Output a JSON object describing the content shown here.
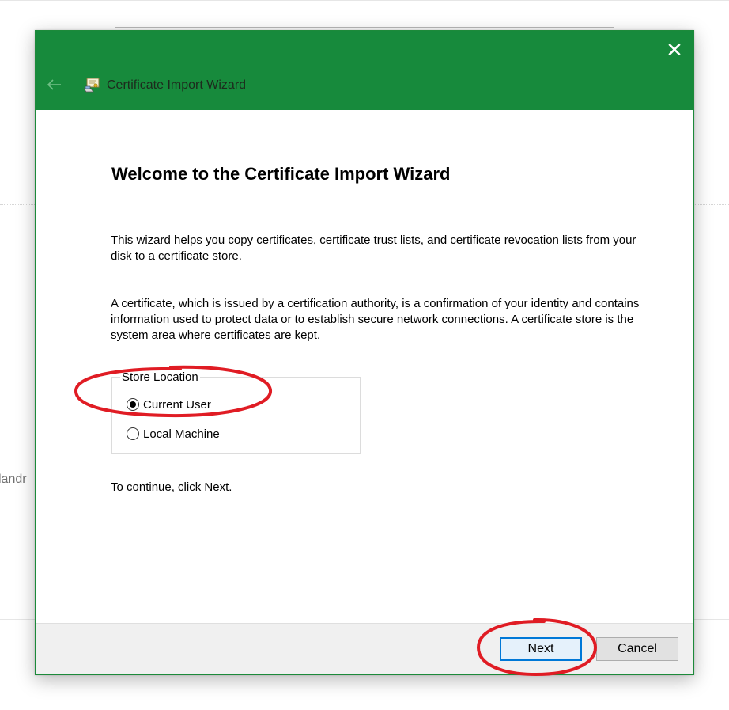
{
  "background": {
    "partial_text": "landr"
  },
  "window": {
    "title": "Certificate Import Wizard",
    "titlebar_color": "#178a3c",
    "close_glyph": "✕",
    "back_icon": "back-arrow-icon",
    "app_icon": "certificate-icon"
  },
  "content": {
    "heading": "Welcome to the Certificate Import Wizard",
    "paragraph1": "This wizard helps you copy certificates, certificate trust lists, and certificate revocation lists from your disk to a certificate store.",
    "paragraph2": "A certificate, which is issued by a certification authority, is a confirmation of your identity and contains information used to protect data or to establish secure network connections. A certificate store is the system area where certificates are kept.",
    "store_location": {
      "label": "Store Location",
      "options": [
        {
          "label": "Current User",
          "selected": true
        },
        {
          "label": "Local Machine",
          "selected": false
        }
      ]
    },
    "continue_text": "To continue, click Next."
  },
  "footer": {
    "next_label": "Next",
    "cancel_label": "Cancel",
    "accent_color": "#0078d7"
  },
  "annotations": {
    "highlight_color": "#e01c24"
  }
}
